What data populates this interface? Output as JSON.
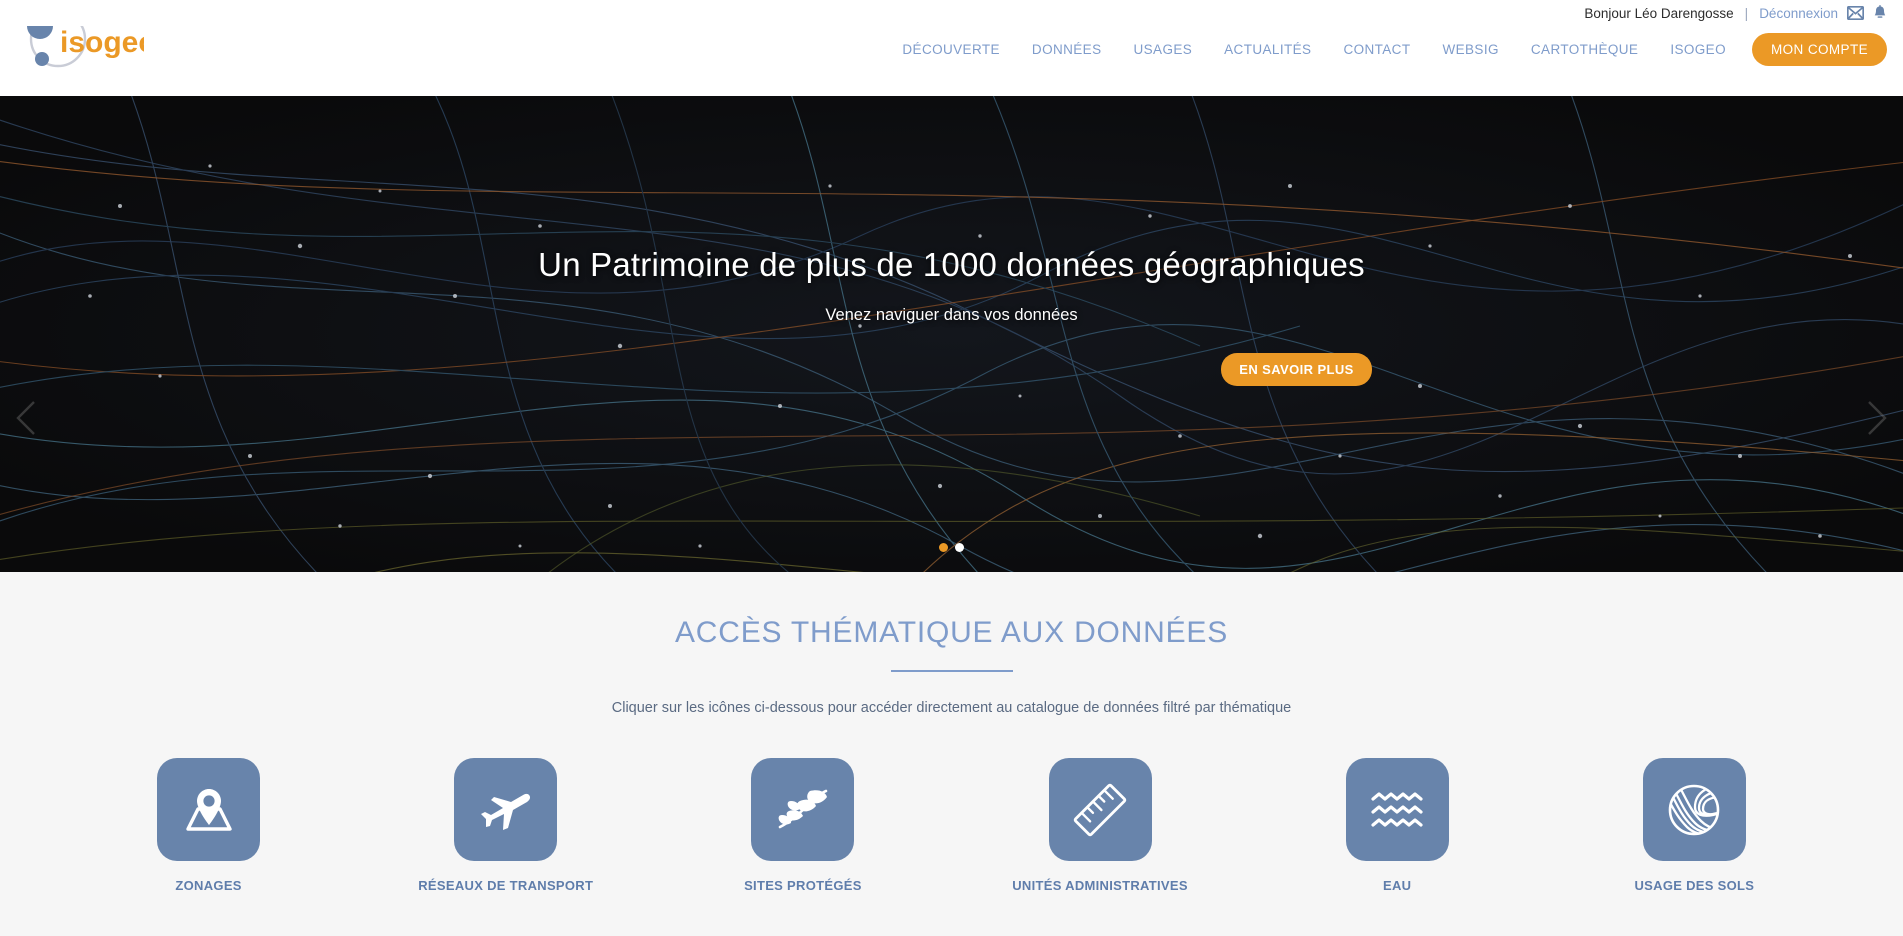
{
  "topbar": {
    "greeting": "Bonjour Léo Darengosse",
    "separator": "|",
    "logout_label": "Déconnexion",
    "mail_icon": "envelope-icon",
    "bell_icon": "bell-icon"
  },
  "header": {
    "logo_text": "isogeo",
    "nav": [
      {
        "label": "DÉCOUVERTE"
      },
      {
        "label": "DONNÉES"
      },
      {
        "label": "USAGES"
      },
      {
        "label": "ACTUALITÉS"
      },
      {
        "label": "CONTACT"
      },
      {
        "label": "WEBSIG"
      },
      {
        "label": "CARTOTHÈQUE"
      },
      {
        "label": "ISOGEO"
      }
    ],
    "account_button": "MON COMPTE"
  },
  "hero": {
    "title": "Un Patrimoine de plus de 1000 données géographiques",
    "subtitle": "Venez naviguer dans vos données",
    "cta_label": "EN SAVOIR PLUS",
    "prev_icon": "chevron-left-icon",
    "next_icon": "chevron-right-icon",
    "slides": [
      {
        "active": true
      },
      {
        "active": false
      }
    ]
  },
  "thematic": {
    "title": "ACCÈS THÉMATIQUE AUX DONNÉES",
    "subtitle": "Cliquer sur les icônes ci-dessous pour accéder directement au catalogue de données filtré par thématique",
    "items": [
      {
        "label": "ZONAGES",
        "icon": "map-pin-icon"
      },
      {
        "label": "RÉSEAUX DE TRANSPORT",
        "icon": "airplane-icon"
      },
      {
        "label": "SITES PROTÉGÉS",
        "icon": "leaf-branch-icon"
      },
      {
        "label": "UNITÉS ADMINISTRATIVES",
        "icon": "ruler-icon"
      },
      {
        "label": "EAU",
        "icon": "waves-icon"
      },
      {
        "label": "USAGE DES SOLS",
        "icon": "contour-globe-icon"
      }
    ]
  },
  "colors": {
    "brand_orange": "#eb9926",
    "brand_blue": "#7f9ccb",
    "tile_blue": "#6884ab",
    "hero_bg": "#0d0d0e",
    "section_bg": "#f6f6f6"
  }
}
